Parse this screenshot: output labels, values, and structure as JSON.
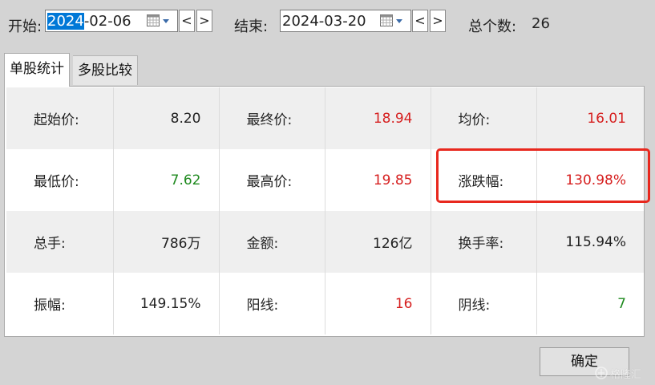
{
  "range": {
    "start_label": "开始:",
    "start_sel": "2024",
    "start_rest": "-02-06",
    "end_label": "结束:",
    "end_value": "2024-03-20",
    "prev_btn": "<",
    "next_btn": ">",
    "count_label": "总个数:",
    "count_value": "26"
  },
  "tabs": [
    {
      "label": "单股统计",
      "active": true
    },
    {
      "label": "多股比较",
      "active": false
    }
  ],
  "stats": {
    "rows": [
      [
        {
          "key": "起始价:",
          "value": "8.20",
          "color": "black"
        },
        {
          "key": "最终价:",
          "value": "18.94",
          "color": "red"
        },
        {
          "key": "均价:",
          "value": "16.01",
          "color": "red"
        }
      ],
      [
        {
          "key": "最低价:",
          "value": "7.62",
          "color": "green"
        },
        {
          "key": "最高价:",
          "value": "19.85",
          "color": "red"
        },
        {
          "key": "涨跌幅:",
          "value": "130.98%",
          "color": "red"
        }
      ],
      [
        {
          "key": "总手:",
          "value": "786万",
          "color": "black"
        },
        {
          "key": "金额:",
          "value": "126亿",
          "color": "black"
        },
        {
          "key": "换手率:",
          "value": "115.94%",
          "color": "black"
        }
      ],
      [
        {
          "key": "振幅:",
          "value": "149.15%",
          "color": "black"
        },
        {
          "key": "阳线:",
          "value": "16",
          "color": "red"
        },
        {
          "key": "阴线:",
          "value": "7",
          "color": "green"
        }
      ]
    ]
  },
  "ok_button": "确定",
  "watermark": "格隆汇",
  "colors": {
    "up_red": "#d61f1f",
    "down_green": "#1f8a1f",
    "highlight_red": "#e8281e",
    "selection_blue": "#0078d7"
  }
}
